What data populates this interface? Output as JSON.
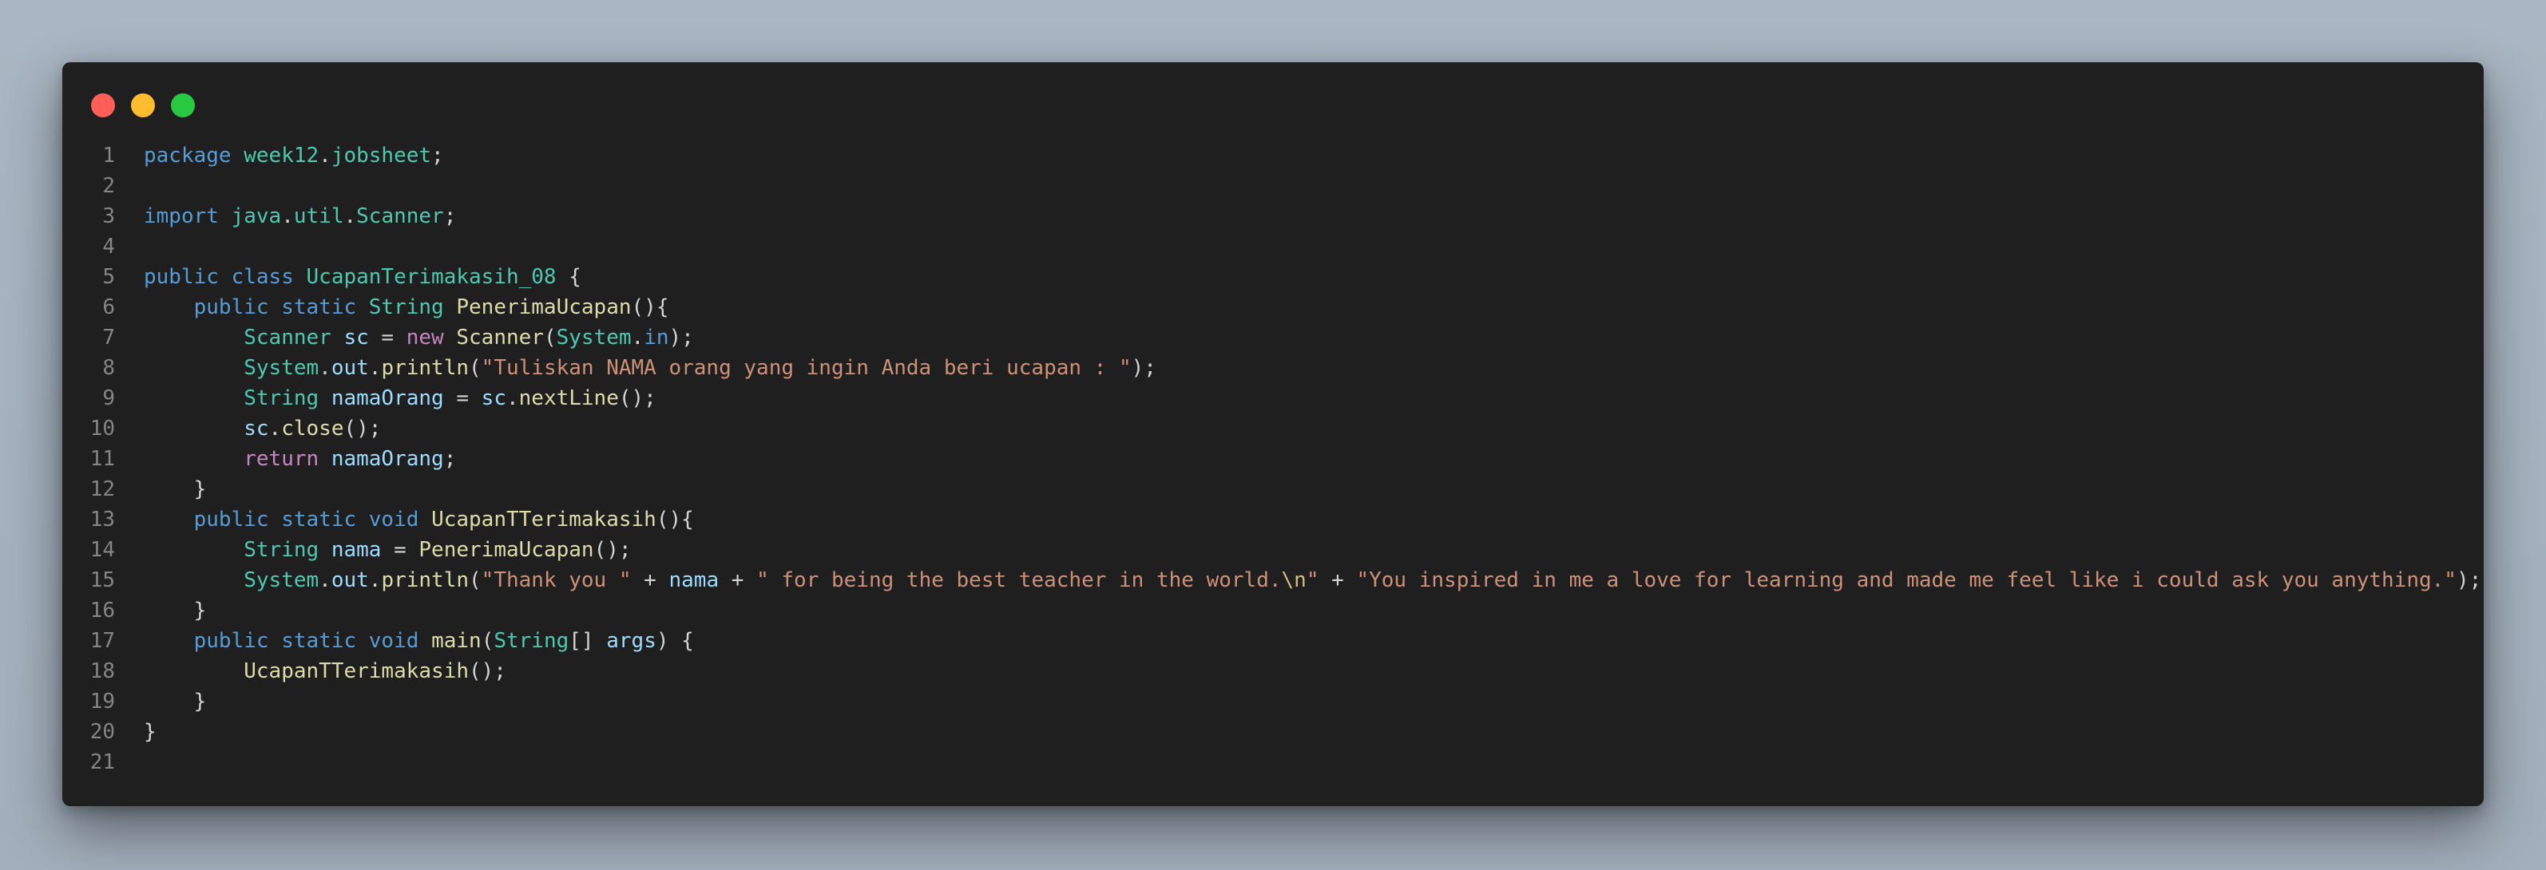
{
  "window": {
    "controls": [
      "close",
      "minimize",
      "maximize"
    ]
  },
  "colors": {
    "keyword": "#569cd6",
    "control_keyword": "#c586c0",
    "type": "#4ec9b0",
    "function": "#dcdcaa",
    "variable": "#9cdcfe",
    "string": "#ce9178",
    "plain": "#d4d4d4",
    "line_number": "#858585",
    "background": "#1f1f1f"
  },
  "code": {
    "lines": [
      [
        [
          "kw",
          "package"
        ],
        [
          "p",
          " "
        ],
        [
          "type",
          "week12"
        ],
        [
          "p",
          "."
        ],
        [
          "type",
          "jobsheet"
        ],
        [
          "p",
          ";"
        ]
      ],
      [],
      [
        [
          "kw",
          "import"
        ],
        [
          "p",
          " "
        ],
        [
          "type",
          "java"
        ],
        [
          "p",
          "."
        ],
        [
          "type",
          "util"
        ],
        [
          "p",
          "."
        ],
        [
          "type",
          "Scanner"
        ],
        [
          "p",
          ";"
        ]
      ],
      [],
      [
        [
          "kw",
          "public"
        ],
        [
          "p",
          " "
        ],
        [
          "kw",
          "class"
        ],
        [
          "p",
          " "
        ],
        [
          "type",
          "UcapanTerimakasih_08"
        ],
        [
          "p",
          " {"
        ]
      ],
      [
        [
          "p",
          "    "
        ],
        [
          "kw",
          "public"
        ],
        [
          "p",
          " "
        ],
        [
          "kw",
          "static"
        ],
        [
          "p",
          " "
        ],
        [
          "type",
          "String"
        ],
        [
          "p",
          " "
        ],
        [
          "fn",
          "PenerimaUcapan"
        ],
        [
          "p",
          "(){"
        ]
      ],
      [
        [
          "p",
          "        "
        ],
        [
          "type",
          "Scanner"
        ],
        [
          "p",
          " "
        ],
        [
          "var",
          "sc"
        ],
        [
          "p",
          " = "
        ],
        [
          "kw2",
          "new"
        ],
        [
          "p",
          " "
        ],
        [
          "fn",
          "Scanner"
        ],
        [
          "p",
          "("
        ],
        [
          "type",
          "System"
        ],
        [
          "p",
          "."
        ],
        [
          "kw",
          "in"
        ],
        [
          "p",
          ");"
        ]
      ],
      [
        [
          "p",
          "        "
        ],
        [
          "type",
          "System"
        ],
        [
          "p",
          "."
        ],
        [
          "var",
          "out"
        ],
        [
          "p",
          "."
        ],
        [
          "fn",
          "println"
        ],
        [
          "p",
          "("
        ],
        [
          "str",
          "\"Tuliskan NAMA orang yang ingin Anda beri ucapan : \""
        ],
        [
          "p",
          ");"
        ]
      ],
      [
        [
          "p",
          "        "
        ],
        [
          "type",
          "String"
        ],
        [
          "p",
          " "
        ],
        [
          "var",
          "namaOrang"
        ],
        [
          "p",
          " = "
        ],
        [
          "var",
          "sc"
        ],
        [
          "p",
          "."
        ],
        [
          "fn",
          "nextLine"
        ],
        [
          "p",
          "();"
        ]
      ],
      [
        [
          "p",
          "        "
        ],
        [
          "var",
          "sc"
        ],
        [
          "p",
          "."
        ],
        [
          "fn",
          "close"
        ],
        [
          "p",
          "();"
        ]
      ],
      [
        [
          "p",
          "        "
        ],
        [
          "kw2",
          "return"
        ],
        [
          "p",
          " "
        ],
        [
          "var",
          "namaOrang"
        ],
        [
          "p",
          ";"
        ]
      ],
      [
        [
          "p",
          "    }"
        ]
      ],
      [
        [
          "p",
          "    "
        ],
        [
          "kw",
          "public"
        ],
        [
          "p",
          " "
        ],
        [
          "kw",
          "static"
        ],
        [
          "p",
          " "
        ],
        [
          "kw",
          "void"
        ],
        [
          "p",
          " "
        ],
        [
          "fn",
          "UcapanTTerimakasih"
        ],
        [
          "p",
          "(){"
        ]
      ],
      [
        [
          "p",
          "        "
        ],
        [
          "type",
          "String"
        ],
        [
          "p",
          " "
        ],
        [
          "var",
          "nama"
        ],
        [
          "p",
          " = "
        ],
        [
          "fn",
          "PenerimaUcapan"
        ],
        [
          "p",
          "();"
        ]
      ],
      [
        [
          "p",
          "        "
        ],
        [
          "type",
          "System"
        ],
        [
          "p",
          "."
        ],
        [
          "var",
          "out"
        ],
        [
          "p",
          "."
        ],
        [
          "fn",
          "println"
        ],
        [
          "p",
          "("
        ],
        [
          "str",
          "\"Thank you \""
        ],
        [
          "p",
          " + "
        ],
        [
          "var",
          "nama"
        ],
        [
          "p",
          " + "
        ],
        [
          "str",
          "\" for being the best teacher in the world."
        ],
        [
          "esc",
          "\\n"
        ],
        [
          "str",
          "\""
        ],
        [
          "p",
          " + "
        ],
        [
          "str",
          "\"You inspired in me a love for learning and made me feel like i could ask you anything.\""
        ],
        [
          "p",
          ");"
        ]
      ],
      [
        [
          "p",
          "    }"
        ]
      ],
      [
        [
          "p",
          "    "
        ],
        [
          "kw",
          "public"
        ],
        [
          "p",
          " "
        ],
        [
          "kw",
          "static"
        ],
        [
          "p",
          " "
        ],
        [
          "kw",
          "void"
        ],
        [
          "p",
          " "
        ],
        [
          "fn",
          "main"
        ],
        [
          "p",
          "("
        ],
        [
          "type",
          "String"
        ],
        [
          "p",
          "[] "
        ],
        [
          "var",
          "args"
        ],
        [
          "p",
          ") {"
        ]
      ],
      [
        [
          "p",
          "        "
        ],
        [
          "fn",
          "UcapanTTerimakasih"
        ],
        [
          "p",
          "();"
        ]
      ],
      [
        [
          "p",
          "    }"
        ]
      ],
      [
        [
          "p",
          "}"
        ]
      ],
      []
    ]
  }
}
